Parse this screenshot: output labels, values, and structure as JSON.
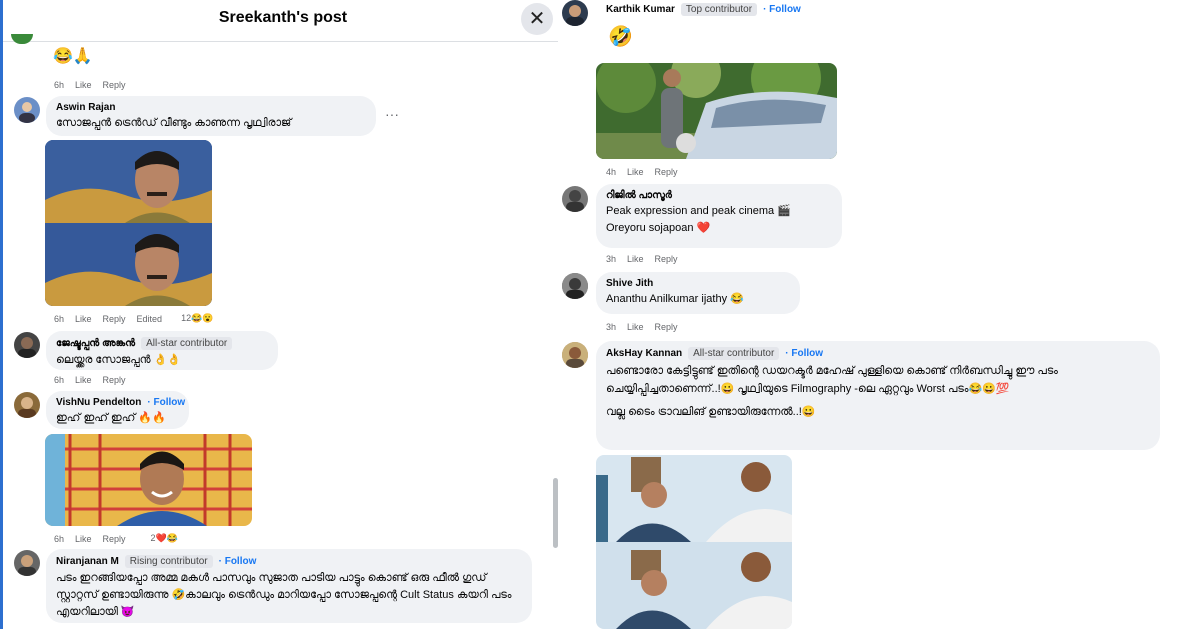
{
  "header": {
    "title": "Sreekanth's post",
    "close_glyph": "✕"
  },
  "left_comments": [
    {
      "emoji_line": "😂🙏",
      "time": "6h",
      "like": "Like",
      "reply": "Reply"
    },
    {
      "name": "Aswin Rajan",
      "text": "സോജപ്പൻ ട്രെൻഡ് വീണ്ടും കാണുന്ന പൃഥ്വിരാജ്",
      "time": "6h",
      "like": "Like",
      "reply": "Reply",
      "edited": "Edited",
      "reactions": "12😂😮",
      "more": "···"
    },
    {
      "name": "ജേഷ്ടപ്പൻ അങ്കൻ",
      "badge": "All-star contributor",
      "text": "ലെയ്ക്കര സോജപ്പൻ 👌👌",
      "time": "6h",
      "like": "Like",
      "reply": "Reply"
    },
    {
      "name": "VishNu Pendelton",
      "follow": "· Follow",
      "text": "ഇഹ് ഇഹ് ഇഹ് 🔥🔥",
      "time": "6h",
      "like": "Like",
      "reply": "Reply",
      "reactions": "2❤️😂"
    },
    {
      "name": "Niranjanan M",
      "badge": "Rising contributor",
      "follow": "· Follow",
      "text": "പടം ഇറങ്ങിയപ്പോ അമ്മ മകൾ പാസവും സുജാത പാടിയ പാട്ടും കൊണ്ട് ഒരു ഫീൽ ഗുഡ് സ്റ്റാറ്റസ് ഉണ്ടായിരുന്നു 🤣കാലവും ട്രെൻഡും മാറിയപ്പോ സോജപ്പന്റെ Cult Status കയറി പടം എയറിലായി 😈"
    }
  ],
  "right_comments": [
    {
      "name": "Karthik Kumar",
      "badge": "Top contributor",
      "follow": "· Follow",
      "emoji_line": "🤣",
      "time": "4h",
      "like": "Like",
      "reply": "Reply"
    },
    {
      "name": "റിജിൽ പാസൂർ",
      "text1": "Peak expression and peak cinema 🎬",
      "text2": "Oreyoru sojapoan ❤️",
      "time": "3h",
      "like": "Like",
      "reply": "Reply"
    },
    {
      "name": "Shive Jith",
      "text": "Ananthu Anilkumar ijathy 😂",
      "time": "3h",
      "like": "Like",
      "reply": "Reply"
    },
    {
      "name": "AksHay Kannan",
      "badge": "All-star contributor",
      "follow": "· Follow",
      "text1": "പണ്ടൊരോ കേട്ടിട്ടുണ്ട് ഇതിന്റെ ഡയറക്ടർ മഹേഷ് പുള്ളിയെ കൊണ്ട് നിർബന്ധിച്ചു ഈ പടം ചെയ്യിപ്പിച്ചതാണെന്ന്..!😀 പൃഥ്വിയുടെ Filmography -ലെ ഏറ്റവും Worst പടം😂😀💯",
      "text2": "വല്ല ടൈം ട്രാവലിങ് ഉണ്ടായിരുന്നേൽ..!😀"
    }
  ]
}
